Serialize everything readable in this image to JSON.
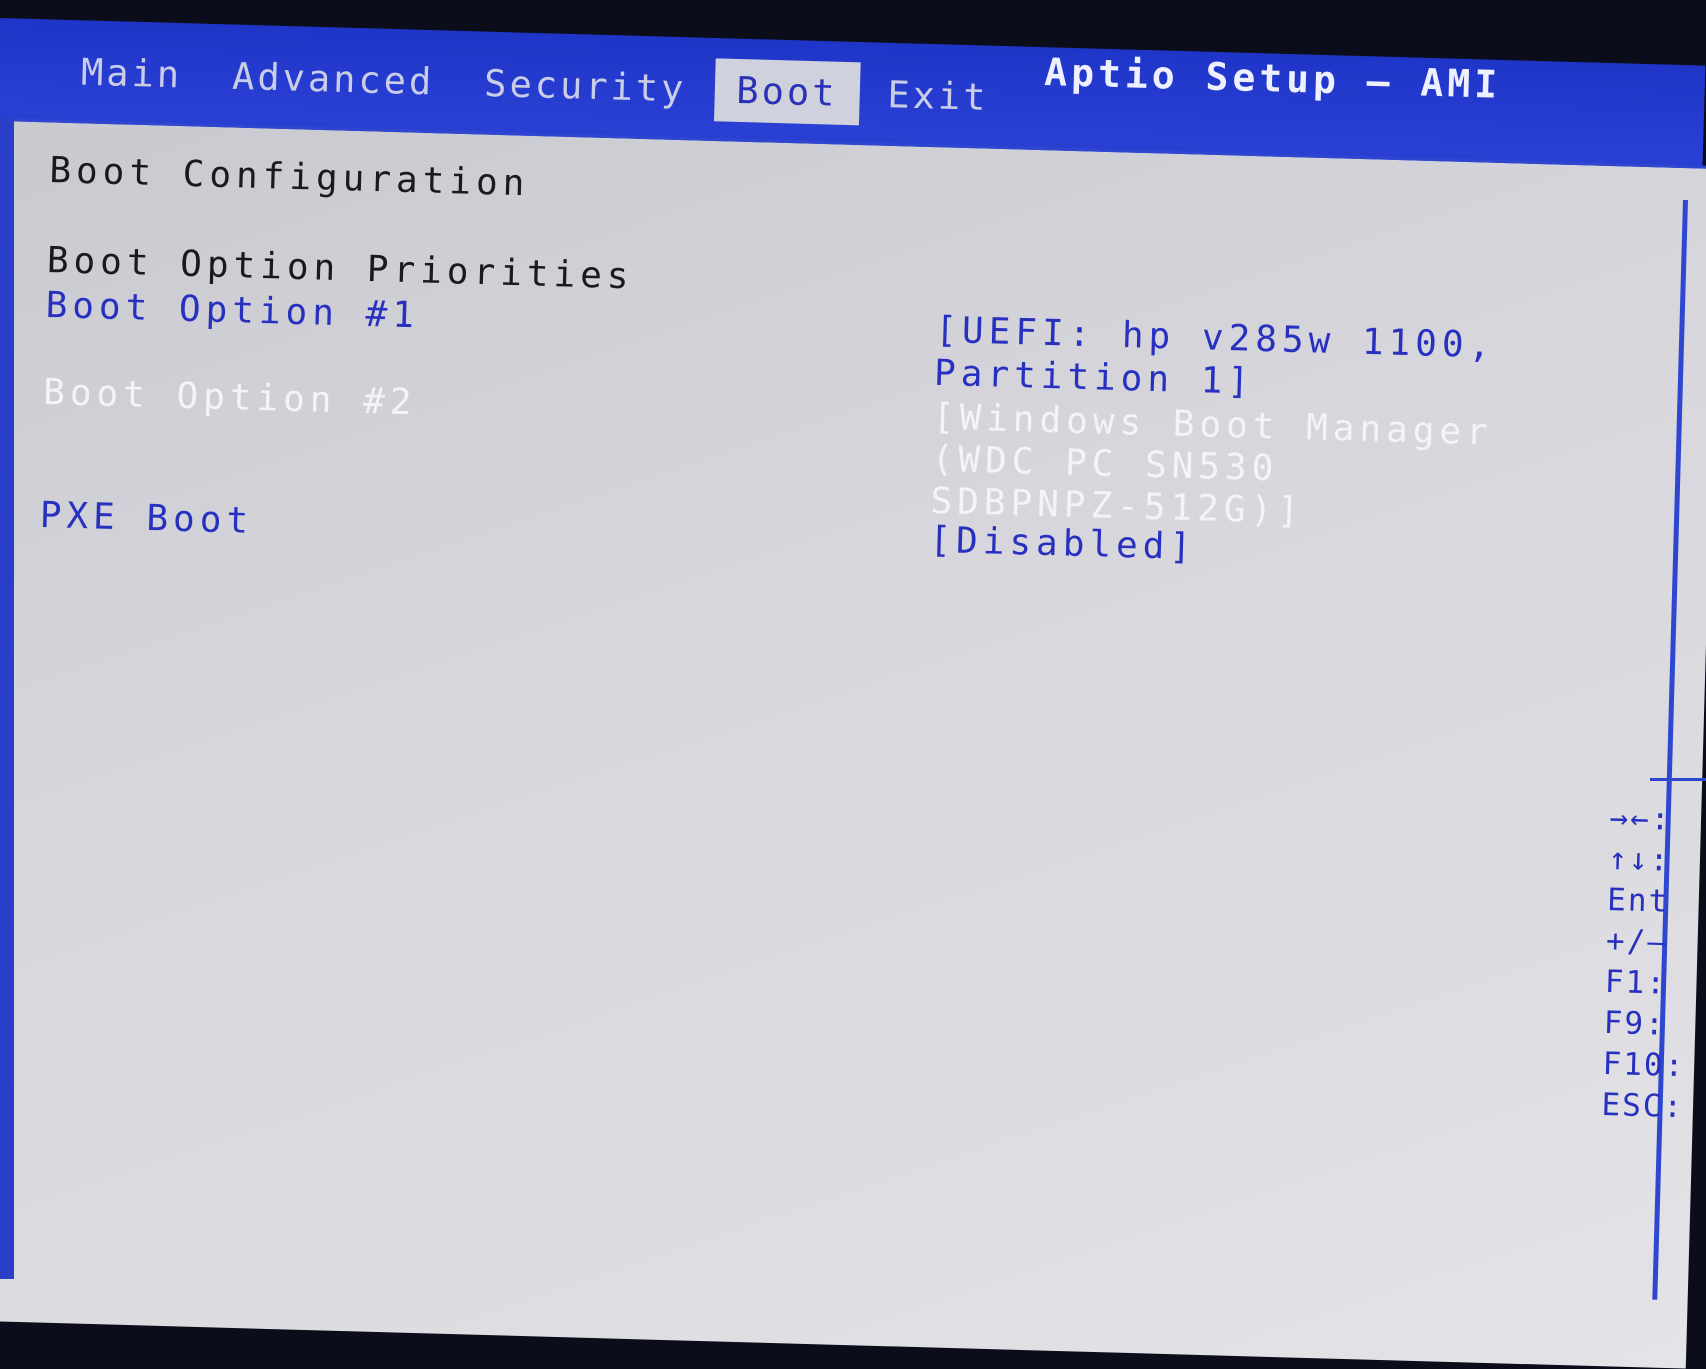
{
  "app": {
    "title": "Aptio Setup – AMI"
  },
  "tabs": [
    {
      "label": "Main"
    },
    {
      "label": "Advanced"
    },
    {
      "label": "Security"
    },
    {
      "label": "Boot",
      "active": true
    },
    {
      "label": "Exit"
    }
  ],
  "section": {
    "title": "Boot Configuration"
  },
  "priorities": {
    "title": "Boot Option Priorities"
  },
  "options": {
    "opt1_label": "Boot Option #1",
    "opt1_value_line1": "[UEFI: hp v285w 1100,",
    "opt1_value_line2": "Partition 1]",
    "opt2_label": "Boot Option #2",
    "opt2_value_line1": "[Windows Boot Manager",
    "opt2_value_line2": "(WDC PC SN530",
    "opt2_value_line3": "SDBPNPZ-512G)]",
    "pxe_label": "PXE Boot",
    "pxe_value": "[Disabled]"
  },
  "help_keys": [
    {
      "key": "→←:",
      "icon": "left-right-arrows-icon"
    },
    {
      "key": "↑↓:",
      "icon": "up-down-arrows-icon"
    },
    {
      "key": "Ent"
    },
    {
      "key": "+/–"
    },
    {
      "key": "F1:"
    },
    {
      "key": "F9:"
    },
    {
      "key": "F10:"
    },
    {
      "key": "ESC:"
    }
  ],
  "colors": {
    "header_blue": "#2438c6",
    "panel_gray": "#d6d6dc",
    "selected_blue": "#2830c0"
  }
}
